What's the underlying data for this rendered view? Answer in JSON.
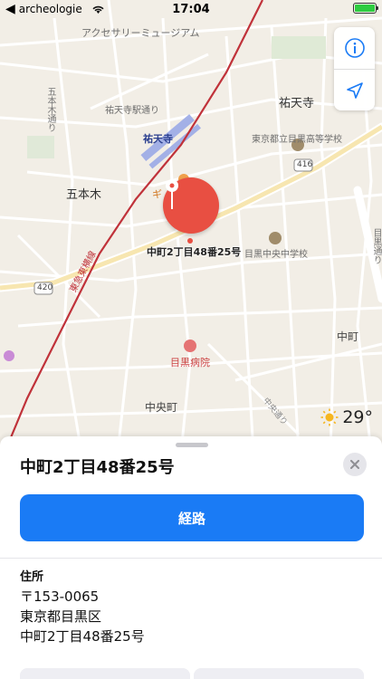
{
  "status_bar": {
    "back_app": "archeologie",
    "time": "17:04"
  },
  "map": {
    "labels": {
      "accessory_museum": "アクセサリーミュージアム",
      "gohongi_street": "五本木通り",
      "yutenji_station_street": "祐天寺駅通り",
      "yutenji": "祐天寺",
      "yutenji_station": "祐天寺",
      "high_school": "東京都立目黒高等学校",
      "gohongi": "五本木",
      "gi": "ギ",
      "route_416": "416",
      "junior_high": "目黒中央中学校",
      "route_420": "420",
      "tokyu_toyoko": "東急東横線",
      "meguro_hospital": "目黒病院",
      "nakacho": "中町",
      "chuocho": "中央町",
      "chuo_street": "中央通り",
      "meguro_street": "目黒通り",
      "pin_label": "中町2丁目48番25号"
    },
    "controls": {
      "info_icon": "info-icon",
      "location_icon": "location-arrow-icon"
    },
    "weather": {
      "icon": "sun-icon",
      "temperature": "29°"
    }
  },
  "sheet": {
    "title": "中町2丁目48番25号",
    "route_button": "経路",
    "address_heading": "住所",
    "address_lines": [
      "〒153-0065",
      "東京都目黒区",
      "中町2丁目48番25号"
    ]
  },
  "colors": {
    "accent": "#1a7bf5",
    "pin": "#e84f42",
    "rail": "#c0323a"
  }
}
